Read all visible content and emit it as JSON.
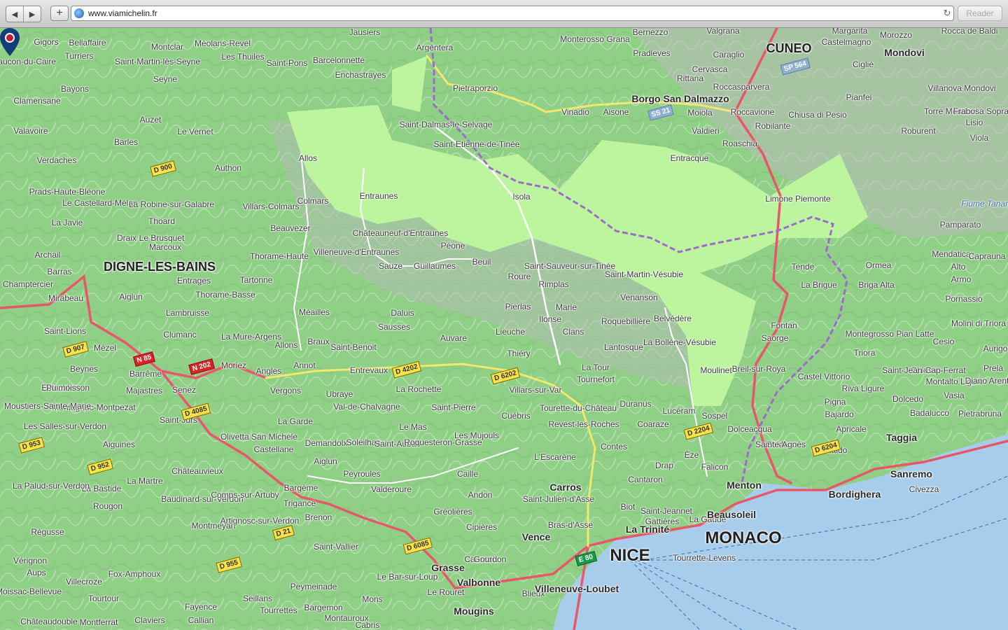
{
  "browser": {
    "url": "www.viamichelin.fr",
    "reader_label": "Reader",
    "back_glyph": "◀",
    "forward_glyph": "▶",
    "add_glyph": "+",
    "reload_glyph": "↻"
  },
  "map": {
    "colors": {
      "land": "#8fcf86",
      "park": "#bdf59f",
      "mountain": "#b9b9b9",
      "sea": "#a8cdea",
      "major_road": "#e8566a",
      "border": "#9b6cc9"
    },
    "marker_label": "Isola",
    "cities": [
      {
        "name": "CUNEO",
        "size": "big"
      },
      {
        "name": "DIGNE-LES-BAINS",
        "size": "big"
      },
      {
        "name": "NICE",
        "size": "huge"
      },
      {
        "name": "MONACO",
        "size": "huge"
      },
      {
        "name": "Grasse",
        "size": "med"
      },
      {
        "name": "Sanremo",
        "size": "med"
      },
      {
        "name": "Borgo San Dalmazzo",
        "size": "med"
      },
      {
        "name": "Mondovi",
        "size": "med"
      },
      {
        "name": "Bordighera",
        "size": "med"
      },
      {
        "name": "Taggia",
        "size": "med"
      },
      {
        "name": "Menton",
        "size": "med"
      },
      {
        "name": "Carros",
        "size": "med"
      },
      {
        "name": "Vence",
        "size": "med"
      },
      {
        "name": "Valbonne",
        "size": "med"
      },
      {
        "name": "Villeneuve-Loubet",
        "size": "med"
      },
      {
        "name": "Mougins",
        "size": "med"
      },
      {
        "name": "Beausoleil",
        "size": "med"
      },
      {
        "name": "La Trinité",
        "size": "med"
      }
    ],
    "towns": [
      "Argentera",
      "Jausiers",
      "Barcelonnette",
      "Enchastrayes",
      "Saint-Pons",
      "Les Thuiles",
      "Méolans-Revel",
      "Montclar",
      "Saint-Martin-lès-Seyne",
      "Bellaffaire",
      "Gigors",
      "Turriers",
      "Faucon-du-Caire",
      "Bayons",
      "Clamensane",
      "Seyne",
      "Auzet",
      "Le Vernet",
      "Valavoire",
      "Barles",
      "Verdaches",
      "Authon",
      "Prads-Haute-Bléone",
      "Le Castellard-Mélan",
      "La Robine-sur-Galabre",
      "La Javie",
      "Thoard",
      "Le Brusquet",
      "Draix",
      "Marcoux",
      "Archail",
      "Barras",
      "Champtercier",
      "Mirabeau",
      "Aiglun",
      "Entrages",
      "Tartonne",
      "Thorame-Basse",
      "Lambruisse",
      "Clumanc",
      "Saint-Lions",
      "Mézel",
      "Beynes",
      "Estoublon",
      "Barrême",
      "Majastres",
      "Senez",
      "Moriez",
      "Angles",
      "Vergons",
      "Annot",
      "Braux",
      "Saint-Benoit",
      "Allons",
      "La Mure-Argens",
      "Méailles",
      "Thorame-Haute",
      "Beauvezer",
      "Villars-Colmars",
      "Colmars",
      "Allos",
      "Entraunes",
      "Châteauneuf-d'Entraunes",
      "Villeneuve-d'Entraunes",
      "Sauze",
      "Guillaumes",
      "Péone",
      "Beuil",
      "Daluis",
      "Sausses",
      "Entrevaux",
      "Ubraye",
      "Val-de-Chalvagne",
      "La Rochette",
      "Saint-Pierre",
      "Auvare",
      "Lieuche",
      "Thiéry",
      "Pierlas",
      "Ilonse",
      "Marie",
      "Roure",
      "Rimplas",
      "Saint-Sauveur-sur-Tinée",
      "Saint-Martin-Vésubie",
      "Venanson",
      "Roquebillière",
      "Belvédère",
      "La Bollène-Vésubie",
      "Lantosque",
      "Clans",
      "La Tour",
      "Tournefort",
      "Villars-sur-Var",
      "Cuébris",
      "Tourette-du-Château",
      "Revest-les-Roches",
      "Duranus",
      "Lucéram",
      "Coaraze",
      "Sospel",
      "Moulinet",
      "Breil-sur-Roya",
      "Saorge",
      "Fontan",
      "Tende",
      "La Brigue",
      "Saint-Dalmas-le-Selvage",
      "Saint-Etienne-de-Tinée",
      "Pietraporzio",
      "Vinadio",
      "Aisone",
      "Moiola",
      "Valdieri",
      "Roaschia",
      "Entracque",
      "Limone Piemonte",
      "Roccavione",
      "Robilante",
      "Chiusa di Pesio",
      "Roccasparvera",
      "Cervasca",
      "Rittana",
      "Valgrana",
      "Caraglio",
      "Bernezzo",
      "Pradleves",
      "Monterosso Grana",
      "Castelmagno",
      "Margarita",
      "Morozzo",
      "Rocca de Baldi",
      "Cigliè",
      "Pianfei",
      "Villanova Mondovi",
      "Torre Mondovi",
      "Roburent",
      "Frabosa Soprana",
      "Lisio",
      "Viola",
      "Pamparato",
      "Ormea",
      "Briga Alta",
      "Mendatica",
      "Caprauna",
      "Alto",
      "Armo",
      "Pornassio",
      "Montegrosso Pian Latte",
      "Triora",
      "Molini di Triora",
      "Cesio",
      "Aurigo",
      "Chiusa",
      "Montalto Ligure",
      "Prelà",
      "Diano Arentino",
      "Vasia",
      "Dolcedo",
      "Badalucco",
      "Pietrabruna",
      "Civezza",
      "Riva Ligure",
      "Castel Vittorio",
      "Pigna",
      "Bajardo",
      "Apricale",
      "Perinaldo",
      "Soldano",
      "Dolceacqua",
      "Olivetta San Michele",
      "Castellane",
      "La Garde",
      "Demandolx",
      "Soleilhas",
      "Saint-Auban",
      "Le Mas",
      "Les Mujouls",
      "Roquesteron-Grasse",
      "Aiglun",
      "Peyroules",
      "Valderoure",
      "Caille",
      "Andon",
      "Gréolières",
      "Cipières",
      "Caussols",
      "Gourdon",
      "Le Bar-sur-Loup",
      "Le Rouret",
      "Cabris",
      "Peymeinade",
      "Saint-Vallier",
      "Seillans",
      "Mons",
      "Bargemon",
      "Montauroux",
      "Tourrettes",
      "Fayence",
      "Callian",
      "Claviers",
      "Montferrat",
      "Châteaudouble",
      "Tourtour",
      "Villecroze",
      "Fox-Amphoux",
      "Aups",
      "Moissac-Bellevue",
      "Vérignon",
      "Régusse",
      "Montmeyan",
      "Artignosc-sur-Verdon",
      "Baudinard-sur-Verdon",
      "Comps-sur-Artuby",
      "Bargème",
      "Trigance",
      "Brenon",
      "Châteauvieux",
      "La Martre",
      "La Bastide",
      "Rougon",
      "La Palud-sur-Verdon",
      "Aiguines",
      "Les Salles-sur-Verdon",
      "Montagnac-Montpezat",
      "Moustiers-Sainte-Marie",
      "Puimoisson",
      "Saint-Jurs",
      "Saint-Julien-d'Asse",
      "Bras-d'Asse",
      "Blieux",
      "Saint-Jeannet",
      "Gattières",
      "La Gaude",
      "Biot",
      "Cantaron",
      "Drap",
      "Èze",
      "Falicon",
      "Tourrette-Levens",
      "Contes",
      "L'Escarène",
      "Sainte-Agnès",
      "Saint-Jean-Cap-Ferrat",
      "La Roquette-sur-Var",
      "Saint-Martin-du-Var",
      "Dolceacqua",
      "Aurigo"
    ],
    "road_shields": [
      "N 85",
      "N 202",
      "D 4202",
      "D 6202",
      "D 4085",
      "D 907",
      "D 900",
      "D 955",
      "D 21",
      "D 6085",
      "D 952",
      "D 953",
      "D 2204",
      "D 6204",
      "E 80",
      "SS 21",
      "SP 564"
    ],
    "sea_labels": [
      "Fiume Tanaro"
    ]
  }
}
